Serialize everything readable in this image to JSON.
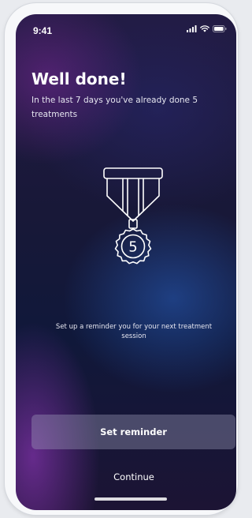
{
  "status_bar": {
    "time": "9:41",
    "icons": [
      "signal-icon",
      "wifi-icon",
      "battery-icon"
    ]
  },
  "main": {
    "title": "Well done!",
    "subtitle": "In the last 7 days you've already done 5 treatments",
    "medal_icon": "medal-icon",
    "medal_number": "5",
    "reminder_text": "Set up a reminder you for your next treatment session"
  },
  "actions": {
    "set_reminder_label": "Set reminder",
    "continue_label": "Continue"
  },
  "colors": {
    "background_top": "#221b43",
    "background_bottom": "#1c1434",
    "accent_purple": "#a53cd2",
    "accent_blue": "#285fbe",
    "button_fill": "#6b6b8a",
    "text": "#ffffff"
  }
}
